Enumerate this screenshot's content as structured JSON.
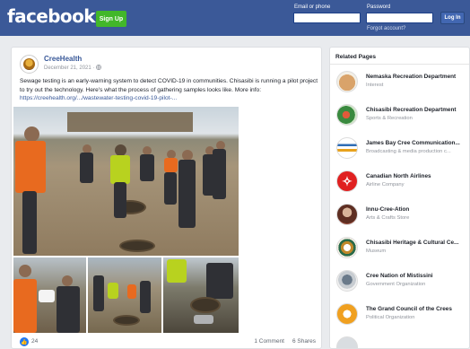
{
  "header": {
    "logo": "facebook",
    "signup_label": "Sign Up",
    "email_label": "Email or phone",
    "password_label": "Password",
    "forgot_label": "Forgot account?",
    "login_label": "Log In"
  },
  "post": {
    "author": "CreeHealth",
    "date": "December 21, 2021 ·",
    "audience_icon": "globe-icon",
    "text": "Sewage testing is an early-warning system to detect COVID-19 in communities. Chisasibi is running a pilot project to try out the technology. Here's what the process of gathering samples looks like. More info:",
    "link": "https://creehealth.org/.../wastewater-testing-covid-19-pilot-...",
    "likes": "24",
    "comments": "1 Comment",
    "shares": "6 Shares",
    "colors": {
      "link": "#385898",
      "like": "#2078f4"
    }
  },
  "sidebar": {
    "title": "Related Pages",
    "pages": [
      {
        "name": "Nemaska Recreation Department",
        "category": "Interest",
        "color": "#c89b62"
      },
      {
        "name": "Chisasibi Recreation Department",
        "category": "Sports & Recreation",
        "color": "#3a8a3f"
      },
      {
        "name": "James Bay Cree Communication...",
        "category": "Broadcasting & media production c...",
        "color": "#ffffff"
      },
      {
        "name": "Canadian North Airlines",
        "category": "Airline Company",
        "color": "#e02020"
      },
      {
        "name": "Innu-Cree-Ation",
        "category": "Arts & Crafts Store",
        "color": "#9a4a3a"
      },
      {
        "name": "Chisasibi Heritage & Cultural Ce...",
        "category": "Museum",
        "color": "#c0882a"
      },
      {
        "name": "Cree Nation of Mistissini",
        "category": "Government Organization",
        "color": "#8a9aa8"
      },
      {
        "name": "The Grand Council of the Crees",
        "category": "Political Organization",
        "color": "#f0a020"
      }
    ]
  }
}
